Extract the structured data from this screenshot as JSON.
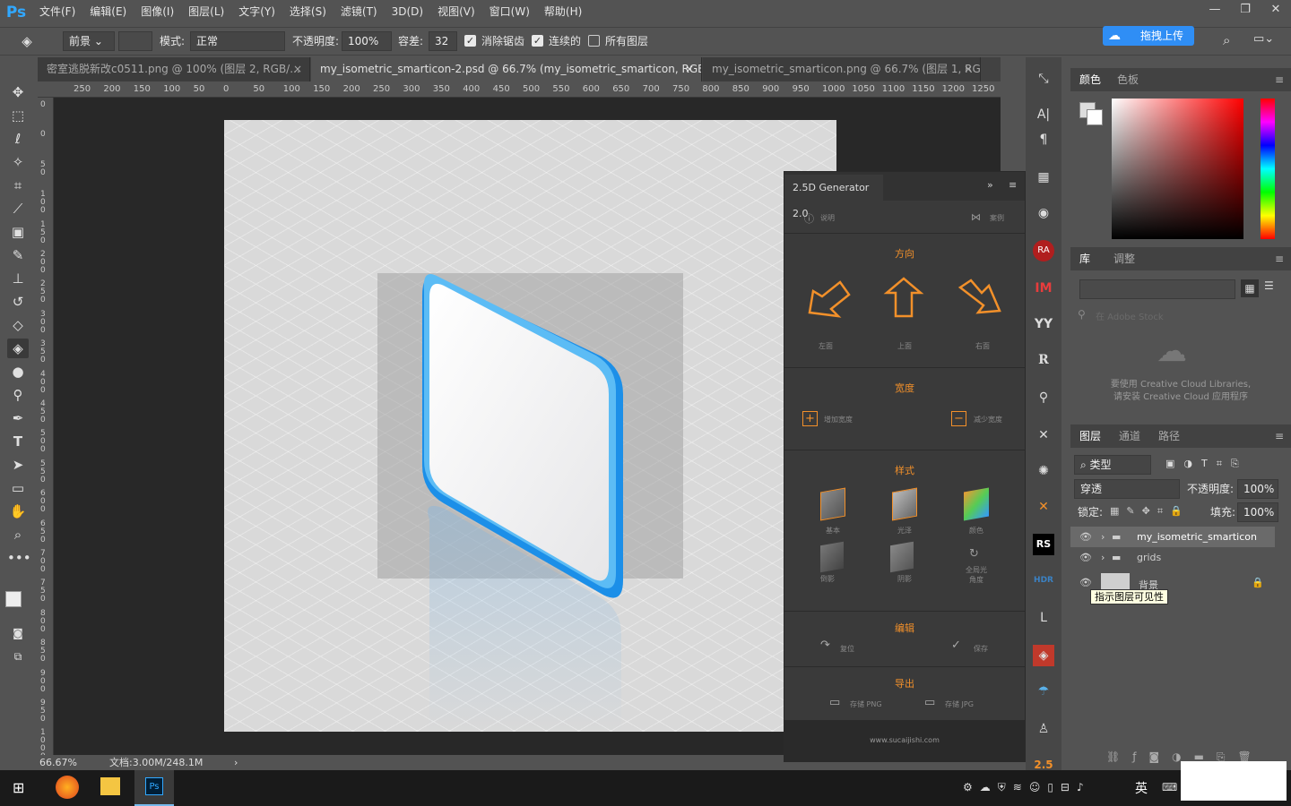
{
  "app": {
    "logo": "Ps",
    "window_controls": [
      "—",
      "❐",
      "✕"
    ]
  },
  "menu": [
    "文件(F)",
    "编辑(E)",
    "图像(I)",
    "图层(L)",
    "文字(Y)",
    "选择(S)",
    "滤镜(T)",
    "3D(D)",
    "视图(V)",
    "窗口(W)",
    "帮助(H)"
  ],
  "options": {
    "fill_source": "前景",
    "mode_label": "模式:",
    "mode_value": "正常",
    "opacity_label": "不透明度:",
    "opacity_value": "100%",
    "tolerance_label": "容差:",
    "tolerance_value": "32",
    "antialias_label": "消除锯齿",
    "contiguous_label": "连续的",
    "all_layers_label": "所有图层",
    "upload_label": "拖拽上传"
  },
  "tabs": [
    {
      "label": "密室逃脱新改c0511.png @ 100% (图层 2, RGB/...",
      "close": "×"
    },
    {
      "label": "my_isometric_smarticon-2.psd @ 66.7% (my_isometric_smarticon, RGB/8) *",
      "close": "×"
    },
    {
      "label": "my_isometric_smarticon.png @ 66.7% (图层 1, RG...",
      "close": "×"
    }
  ],
  "ruler_h": [
    "250",
    "200",
    "150",
    "100",
    "50",
    "0",
    "50",
    "100",
    "150",
    "200",
    "250",
    "300",
    "350",
    "400",
    "450",
    "500",
    "550",
    "600",
    "650",
    "700",
    "750",
    "800",
    "850",
    "900",
    "950",
    "1000",
    "1050",
    "1100",
    "1150",
    "1200",
    "1250",
    "1"
  ],
  "ruler_v": [
    "0",
    "0",
    "5 0",
    "1 0 0",
    "1 5 0",
    "2 0 0",
    "2 5 0",
    "3 0 0",
    "3 5 0",
    "4 0 0",
    "4 5 0",
    "5 0 0",
    "5 5 0",
    "6 0 0",
    "6 5 0",
    "7 0 0",
    "7 5 0",
    "8 0 0",
    "8 5 0",
    "9 0 0",
    "9 5 0",
    "1 0 0 0"
  ],
  "status": {
    "zoom": "66.67%",
    "doc": "文档:3.00M/248.1M",
    "arrow": "›"
  },
  "generator": {
    "title": "2.5D Generator 2.0",
    "help": "说明",
    "cases": "案例",
    "direction_title": "方向",
    "left": "左面",
    "up": "上面",
    "right": "右面",
    "width_title": "宽度",
    "add_width": "增加宽度",
    "reduce_width": "减少宽度",
    "style_title": "样式",
    "basic": "基本",
    "gloss": "光泽",
    "color": "颜色",
    "reflection": "倒影",
    "shadow": "阴影",
    "global_light": "全局光\n角度",
    "edit_title": "编辑",
    "reset": "复位",
    "save": "保存",
    "export_title": "导出",
    "save_png": "存储 PNG",
    "save_jpg": "存储 JPG",
    "footer": "www.sucaijishi.com"
  },
  "right": {
    "color_tab": "颜色",
    "swatch_tab": "色板",
    "lib_tab": "库",
    "adjust_tab": "调整",
    "lib_search": "在 Adobe Stock",
    "lib_msg1": "要使用 Creative Cloud Libraries,",
    "lib_msg2": "请安装 Creative Cloud 应用程序",
    "layers_tab": "图层",
    "channels_tab": "通道",
    "paths_tab": "路径",
    "filter_kind": "类型",
    "blend_mode": "穿透",
    "opacity_label": "不透明度:",
    "opacity_value": "100%",
    "lock_label": "锁定:",
    "fill_label": "填充:",
    "fill_value": "100%",
    "layers": [
      "my_isometric_smarticon",
      "grids",
      "背景"
    ],
    "tooltip": "指示图层可见性"
  },
  "midcol": [
    "A|",
    "¶",
    "RA",
    "IM",
    "YY",
    "R",
    "RS",
    "HDR",
    "2.5"
  ],
  "taskbar": {
    "ime": "英"
  },
  "colors": {
    "accent": "#f2902a",
    "ps_blue": "#31a8ff",
    "icon_blue": "#1c8fe8"
  }
}
